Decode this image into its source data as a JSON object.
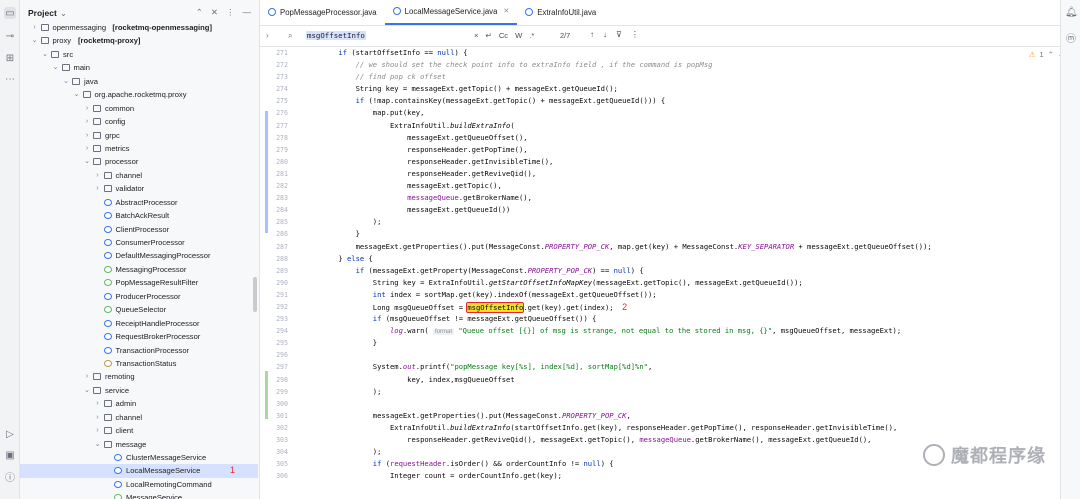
{
  "project_panel": {
    "title": "Project",
    "tree": [
      {
        "label": "openmessaging",
        "bold_suffix": "[rocketmq-openmessaging]",
        "depth": 1,
        "arrow": "›",
        "icon": "folder"
      },
      {
        "label": "proxy",
        "bold_suffix": "[rocketmq-proxy]",
        "depth": 1,
        "arrow": "⌄",
        "icon": "folder"
      },
      {
        "label": "src",
        "depth": 2,
        "arrow": "⌄",
        "icon": "folder"
      },
      {
        "label": "main",
        "depth": 3,
        "arrow": "⌄",
        "icon": "folder"
      },
      {
        "label": "java",
        "depth": 4,
        "arrow": "⌄",
        "icon": "folder"
      },
      {
        "label": "org.apache.rocketmq.proxy",
        "depth": 5,
        "arrow": "⌄",
        "icon": "pkg"
      },
      {
        "label": "common",
        "depth": 6,
        "arrow": "›",
        "icon": "pkg"
      },
      {
        "label": "config",
        "depth": 6,
        "arrow": "›",
        "icon": "pkg"
      },
      {
        "label": "grpc",
        "depth": 6,
        "arrow": "›",
        "icon": "pkg"
      },
      {
        "label": "metrics",
        "depth": 6,
        "arrow": "›",
        "icon": "pkg"
      },
      {
        "label": "processor",
        "depth": 6,
        "arrow": "⌄",
        "icon": "pkg"
      },
      {
        "label": "channel",
        "depth": 7,
        "arrow": "›",
        "icon": "pkg"
      },
      {
        "label": "validator",
        "depth": 7,
        "arrow": "›",
        "icon": "pkg"
      },
      {
        "label": "AbstractProcessor",
        "depth": 7,
        "icon": "class"
      },
      {
        "label": "BatchAckResult",
        "depth": 7,
        "icon": "class"
      },
      {
        "label": "ClientProcessor",
        "depth": 7,
        "icon": "class"
      },
      {
        "label": "ConsumerProcessor",
        "depth": 7,
        "icon": "class"
      },
      {
        "label": "DefaultMessagingProcessor",
        "depth": 7,
        "icon": "class"
      },
      {
        "label": "MessagingProcessor",
        "depth": 7,
        "icon": "iface"
      },
      {
        "label": "PopMessageResultFilter",
        "depth": 7,
        "icon": "iface"
      },
      {
        "label": "ProducerProcessor",
        "depth": 7,
        "icon": "class"
      },
      {
        "label": "QueueSelector",
        "depth": 7,
        "icon": "iface"
      },
      {
        "label": "ReceiptHandleProcessor",
        "depth": 7,
        "icon": "class"
      },
      {
        "label": "RequestBrokerProcessor",
        "depth": 7,
        "icon": "class"
      },
      {
        "label": "TransactionProcessor",
        "depth": 7,
        "icon": "class"
      },
      {
        "label": "TransactionStatus",
        "depth": 7,
        "icon": "enum"
      },
      {
        "label": "remoting",
        "depth": 6,
        "arrow": "›",
        "icon": "pkg"
      },
      {
        "label": "service",
        "depth": 6,
        "arrow": "⌄",
        "icon": "pkg"
      },
      {
        "label": "admin",
        "depth": 7,
        "arrow": "›",
        "icon": "pkg"
      },
      {
        "label": "channel",
        "depth": 7,
        "arrow": "›",
        "icon": "pkg"
      },
      {
        "label": "client",
        "depth": 7,
        "arrow": "›",
        "icon": "pkg"
      },
      {
        "label": "message",
        "depth": 7,
        "arrow": "⌄",
        "icon": "pkg"
      },
      {
        "label": "ClusterMessageService",
        "depth": 8,
        "icon": "class"
      },
      {
        "label": "LocalMessageService",
        "depth": 8,
        "icon": "class",
        "selected": true,
        "annotation": "1"
      },
      {
        "label": "LocalRemotingCommand",
        "depth": 8,
        "icon": "class"
      },
      {
        "label": "MessageService",
        "depth": 8,
        "icon": "iface"
      }
    ]
  },
  "tabs": [
    {
      "label": "PopMessageProcessor.java",
      "active": false
    },
    {
      "label": "LocalMessageService.java",
      "active": true
    },
    {
      "label": "ExtraInfoUtil.java",
      "active": false
    }
  ],
  "find": {
    "query": "msgOffsetInfo",
    "opt_case": "Cc",
    "opt_word": "W",
    "opt_regex": ".*",
    "count": "2/7"
  },
  "status": {
    "warnings": "1"
  },
  "gutter": {
    "lines": [
      "271",
      "272",
      "273",
      "274",
      "275",
      "276",
      "277",
      "278",
      "279",
      "280",
      "281",
      "282",
      "283",
      "284",
      "285",
      "286",
      "287",
      "288",
      "289",
      "290",
      "291",
      "292",
      "293",
      "294",
      "295",
      "296",
      "297",
      "298",
      "299",
      "300",
      "301",
      "302",
      "303",
      "304",
      "305",
      "306"
    ]
  },
  "code_annotation": "2",
  "watermark": "魔都程序缘"
}
